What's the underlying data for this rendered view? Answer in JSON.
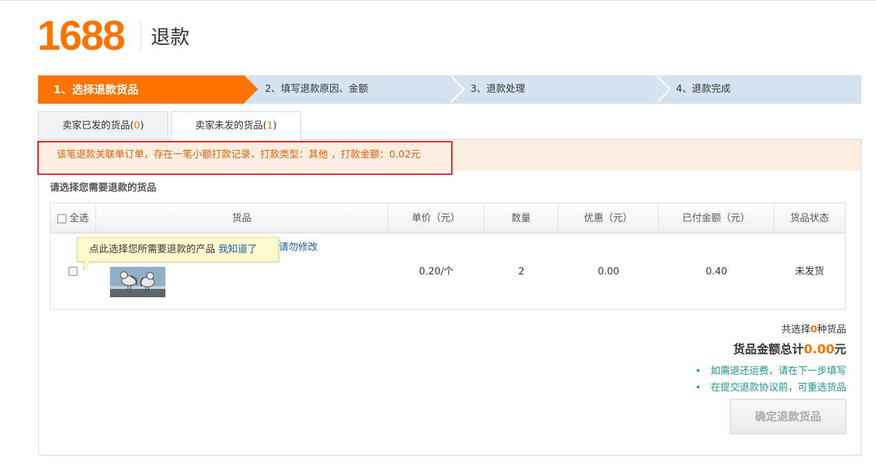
{
  "header": {
    "logo": "1688",
    "title": "退款"
  },
  "steps": [
    {
      "label": "1、选择退款货品",
      "active": true
    },
    {
      "label": "2、填写退款原因、金额",
      "active": false
    },
    {
      "label": "3、退款处理",
      "active": false
    },
    {
      "label": "4、退款完成",
      "active": false
    }
  ],
  "tabs": [
    {
      "label": "卖家已发的货品(",
      "count": "0",
      "close": ")"
    },
    {
      "label": "卖家未发的货品(",
      "count": "1",
      "close": ")"
    }
  ],
  "notice": "该笔退款关联单订单，存在一笔小额打款记录，打款类型：其他 ，打款金额：0.02元",
  "section_label": "请选择您需要退款的货品",
  "table": {
    "headers": {
      "select_all": "全选",
      "product": "货品",
      "unit_price": "单价（元）",
      "quantity": "数量",
      "discount": "优惠（元）",
      "paid": "已付金额（元）",
      "status": "货品状态"
    },
    "rows": [
      {
        "link_text": "请勿修改",
        "unit_price": "0.20/个",
        "quantity": "2",
        "discount": "0.00",
        "paid": "0.40",
        "status": "未发货"
      }
    ]
  },
  "tooltip": {
    "text": "点此选择您所需要退款的产品",
    "link": "我知道了"
  },
  "summary": {
    "count_prefix": "共选择",
    "count": "0",
    "count_suffix": "种货品",
    "total_prefix": "货品金额总计",
    "total": "0.00",
    "total_suffix": "元"
  },
  "hints": [
    "如需退还运费，请在下一步填写",
    "在提交退款协议前，可重选货品"
  ],
  "confirm_button": "确定退款货品",
  "colors": {
    "brand": "#ff7300",
    "step_bg": "#d4e3ef",
    "notice_bg": "#fdeee3",
    "hint": "#1a9a8a",
    "link": "#1a5fa8"
  }
}
